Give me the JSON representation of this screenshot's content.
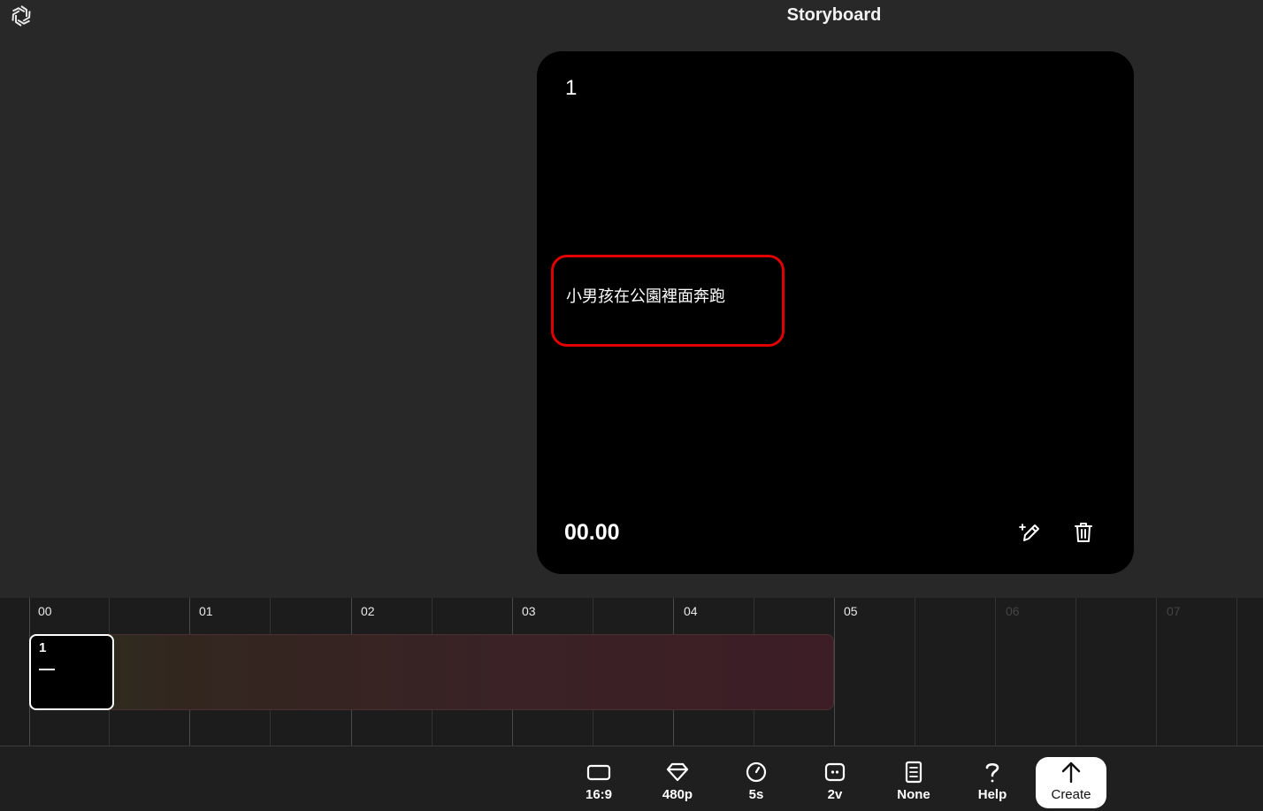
{
  "header": {
    "title": "Storyboard",
    "logo_icon": "openai-logo-icon"
  },
  "scene": {
    "number": "1",
    "caption": "小男孩在公園裡面奔跑",
    "time": "00.00",
    "highlight_color": "#e00000",
    "edit_icon": "magic-pencil-icon",
    "delete_icon": "trash-icon"
  },
  "timeline": {
    "ticks": [
      "00",
      "01",
      "02",
      "03",
      "04",
      "05",
      "06",
      "07"
    ],
    "clip": {
      "number": "1",
      "duration_seconds": 5
    }
  },
  "toolbar": {
    "aspect_ratio": {
      "label": "16:9",
      "icon": "rectangle-icon"
    },
    "resolution": {
      "label": "480p",
      "icon": "diamond-icon"
    },
    "duration": {
      "label": "5s",
      "icon": "clock-icon"
    },
    "variations": {
      "label": "2v",
      "icon": "variations-icon"
    },
    "preset": {
      "label": "None",
      "icon": "preset-icon"
    },
    "help": {
      "label": "Help",
      "icon": "question-icon"
    },
    "create": {
      "label": "Create",
      "icon": "arrow-up-icon"
    }
  }
}
